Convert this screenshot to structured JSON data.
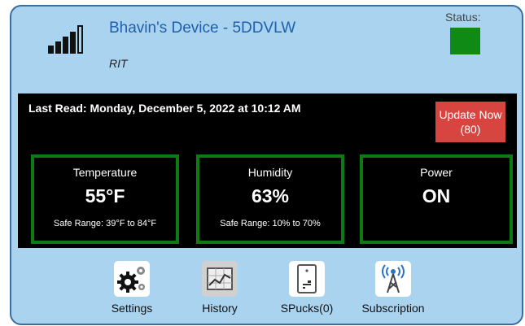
{
  "header": {
    "device_name": "Bhavin's Device - 5DDVLW",
    "location": "RIT",
    "status_label": "Status:",
    "status_color": "#0e8a15"
  },
  "readings": {
    "last_read": "Last Read: Monday, December 5, 2022 at 10:12 AM",
    "update_button": "Update Now (80)",
    "sensors": [
      {
        "title": "Temperature",
        "value": "55°F",
        "range": "Safe Range: 39°F to 84°F"
      },
      {
        "title": "Humidity",
        "value": "63%",
        "range": "Safe Range: 10% to 70%"
      },
      {
        "title": "Power",
        "value": "ON",
        "range": ""
      }
    ]
  },
  "nav": [
    {
      "label": "Settings",
      "icon": "gears-icon"
    },
    {
      "label": "History",
      "icon": "chart-icon"
    },
    {
      "label": "SPucks(0)",
      "icon": "spuck-device-icon"
    },
    {
      "label": "Subscription",
      "icon": "antenna-icon"
    }
  ],
  "colors": {
    "card_bg": "#a9d3ef",
    "panel_bg": "#000000",
    "sensor_border": "#0e7a14",
    "update_button": "#d84440",
    "device_name": "#1f5fae"
  }
}
